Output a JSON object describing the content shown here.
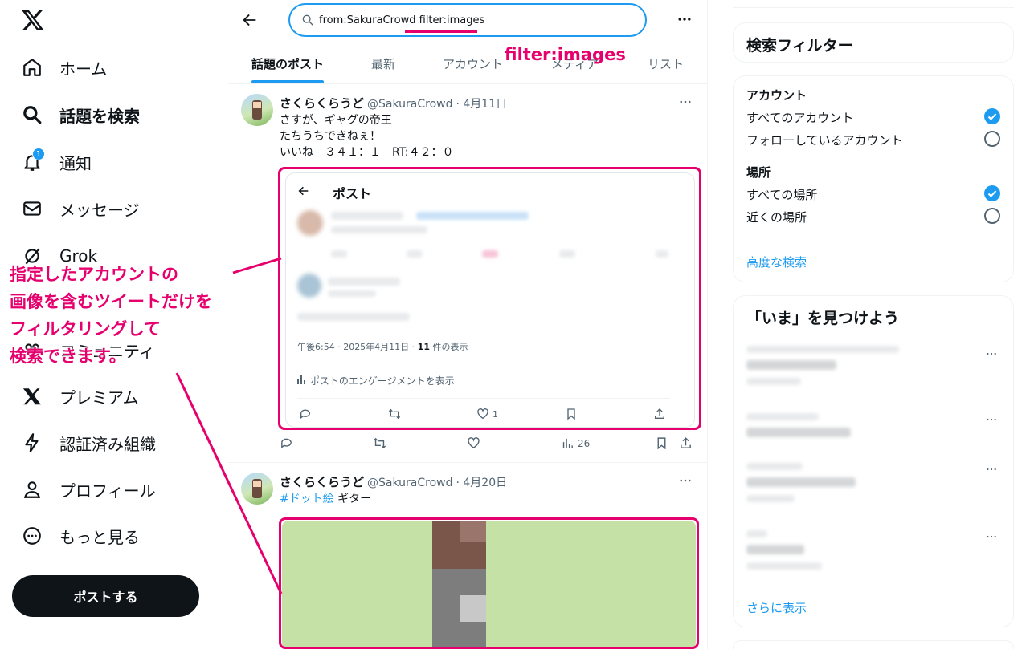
{
  "nav": {
    "items": [
      {
        "label": "ホーム",
        "icon": "home-icon"
      },
      {
        "label": "話題を検索",
        "icon": "search-icon",
        "active": true
      },
      {
        "label": "通知",
        "icon": "bell-icon",
        "badge": "1"
      },
      {
        "label": "メッセージ",
        "icon": "mail-icon"
      },
      {
        "label": "Grok",
        "icon": "grok-icon"
      },
      {
        "label": "コミュニティ",
        "icon": "community-icon"
      },
      {
        "label": "プレミアム",
        "icon": "x-icon"
      },
      {
        "label": "認証済み組織",
        "icon": "bolt-icon"
      },
      {
        "label": "プロフィール",
        "icon": "person-icon"
      },
      {
        "label": "もっと見る",
        "icon": "more-circle-icon"
      }
    ],
    "post_button": "ポストする"
  },
  "search": {
    "query": "from:SakuraCrowd filter:images"
  },
  "tabs": [
    "話題のポスト",
    "最新",
    "アカウント",
    "メディア",
    "リスト"
  ],
  "posts": [
    {
      "name": "さくらくらうど",
      "handle": "@SakuraCrowd",
      "date": "· 4月11日",
      "lines": [
        "さすが、ギャグの帝王",
        "たちうちできねぇ！",
        "いいね　３４１：１　RT:４２：０"
      ],
      "embed": {
        "title": "ポスト",
        "time_prefix": "午後6:54 · 2025年4月11日 · ",
        "views_count": "11",
        "views_suffix": " 件の表示",
        "engagement": "ポストのエンゲージメントを表示",
        "like_count": "1"
      },
      "views": "26"
    },
    {
      "name": "さくらくらうど",
      "handle": "@SakuraCrowd",
      "date": "· 4月20日",
      "hashtag": "#ドット絵",
      "text_suffix": " ギター"
    }
  ],
  "filters": {
    "title": "検索フィルター",
    "account_label": "アカウント",
    "account_options": [
      "すべてのアカウント",
      "フォローしているアカウント"
    ],
    "location_label": "場所",
    "location_options": [
      "すべての場所",
      "近くの場所"
    ],
    "advanced": "高度な検索"
  },
  "trends": {
    "title": "「いま」を見つけよう",
    "show_more": "さらに表示"
  },
  "annotations": {
    "filter_label": "filter:images",
    "callout_lines": [
      "指定したアカウントの",
      "画像を含むツイートだけを",
      "フィルタリングして",
      "検索できます。"
    ]
  },
  "colors": {
    "accent": "#1d9bf0",
    "annotation": "#e6006e",
    "pixel_bg": "#c5e1a5"
  }
}
